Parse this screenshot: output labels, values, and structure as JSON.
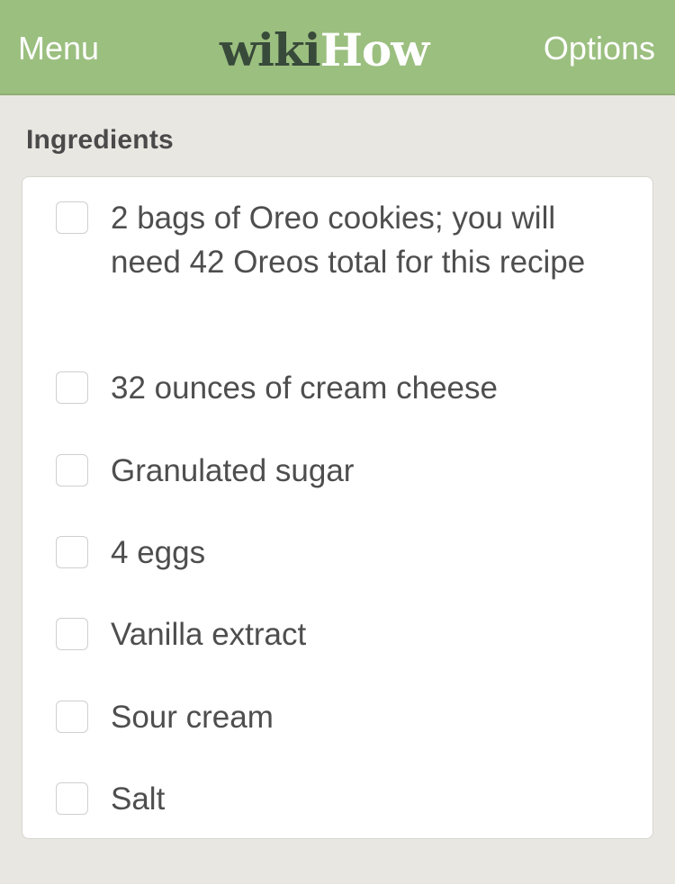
{
  "header": {
    "menu_label": "Menu",
    "logo_wiki": "wiki",
    "logo_how": "How",
    "options_label": "Options"
  },
  "section": {
    "title": "Ingredients"
  },
  "ingredients": [
    {
      "label": "2 bags of Oreo cookies; you will need 42 Oreos total for this recipe",
      "checked": false
    },
    {
      "label": "32 ounces of cream cheese",
      "checked": false
    },
    {
      "label": "Granulated sugar",
      "checked": false
    },
    {
      "label": "4 eggs",
      "checked": false
    },
    {
      "label": "Vanilla extract",
      "checked": false
    },
    {
      "label": "Sour cream",
      "checked": false
    },
    {
      "label": "Salt",
      "checked": false
    }
  ],
  "colors": {
    "header_bg": "#9bbf7f",
    "page_bg": "#e9e7e2",
    "logo_dark": "#384a3a"
  }
}
